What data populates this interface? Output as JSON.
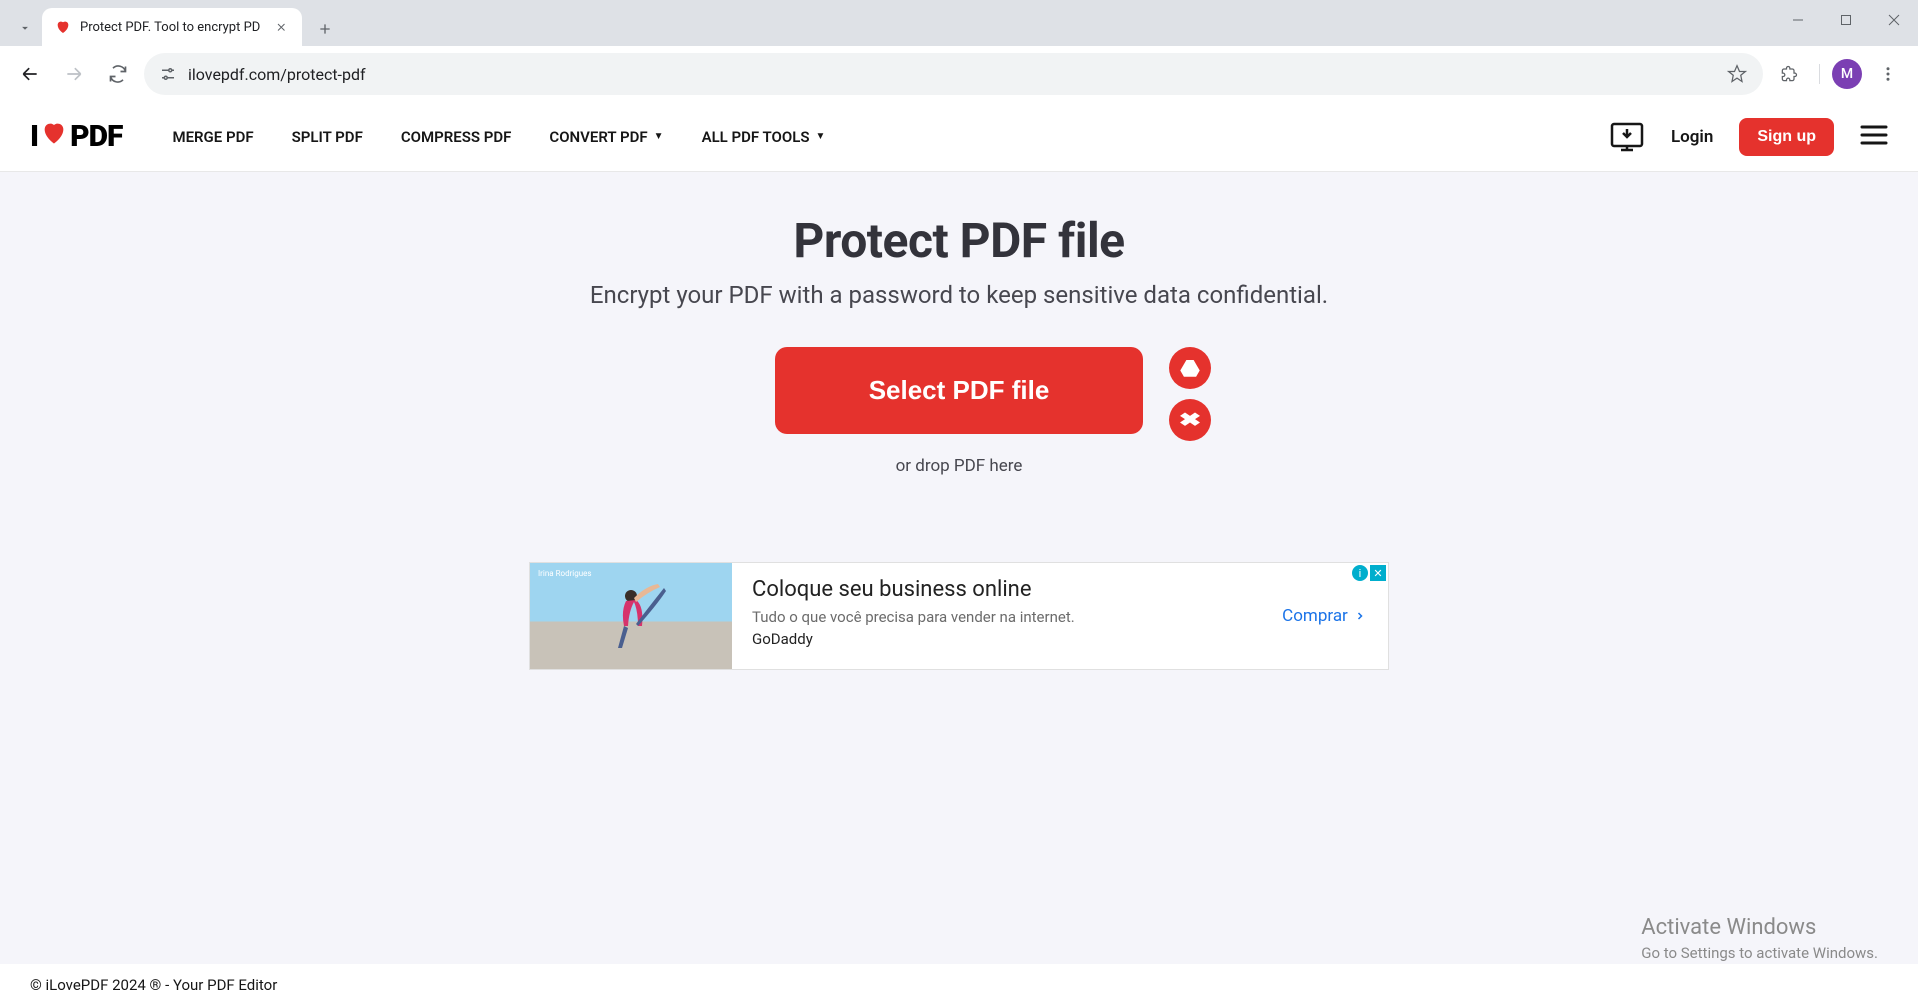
{
  "browser": {
    "tab_title": "Protect PDF. Tool to encrypt PD",
    "url": "ilovepdf.com/protect-pdf",
    "profile_initial": "M"
  },
  "header": {
    "logo_left": "I",
    "logo_right": "PDF",
    "nav": {
      "merge": "MERGE PDF",
      "split": "SPLIT PDF",
      "compress": "COMPRESS PDF",
      "convert": "CONVERT PDF",
      "all_tools": "ALL PDF TOOLS"
    },
    "login": "Login",
    "signup": "Sign up"
  },
  "hero": {
    "title": "Protect PDF file",
    "subtitle": "Encrypt your PDF with a password to keep sensitive data confidential.",
    "select_label": "Select PDF file",
    "drop_hint": "or drop PDF here"
  },
  "ad": {
    "image_label": "Irina Rodrigues",
    "title": "Coloque seu business online",
    "subtitle": "Tudo o que você precisa para vender na internet.",
    "brand": "GoDaddy",
    "cta": "Comprar"
  },
  "watermark": {
    "line1": "Activate Windows",
    "line2": "Go to Settings to activate Windows."
  },
  "footer": {
    "text": "© iLovePDF 2024 ® - Your PDF Editor"
  }
}
